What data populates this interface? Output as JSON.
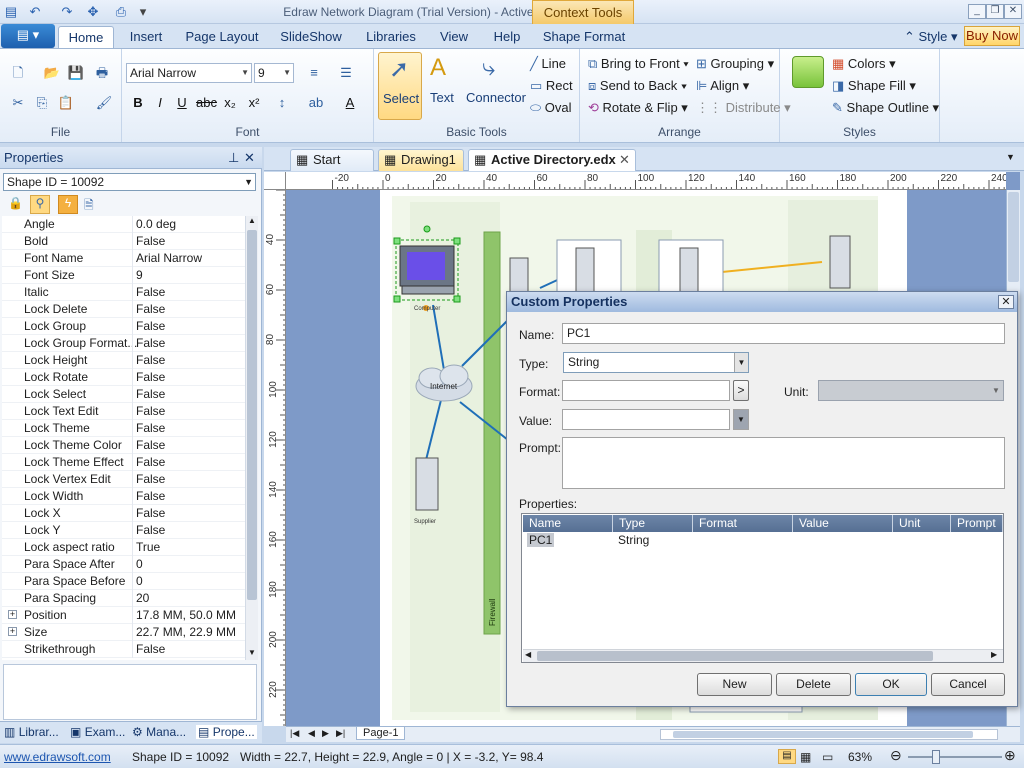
{
  "window": {
    "title": "Edraw Network Diagram (Trial Version) - Active Directory.edx",
    "context_tools": "Context Tools"
  },
  "ribbon": {
    "tabs": [
      "Home",
      "Insert",
      "Page Layout",
      "SlideShow",
      "Libraries",
      "View",
      "Help",
      "Shape Format"
    ],
    "active_tab": "Home",
    "style_label": "Style",
    "buy_now": "Buy Now",
    "font_name": "Arial Narrow",
    "font_size": "9",
    "basic_tools": {
      "select": "Select",
      "text": "Text",
      "connector": "Connector",
      "line": "Line",
      "rect": "Rect",
      "oval": "Oval"
    },
    "arrange": {
      "bring_to_front": "Bring to Front",
      "send_to_back": "Send to Back",
      "rotate_flip": "Rotate & Flip",
      "grouping": "Grouping",
      "align": "Align",
      "distribute": "Distribute"
    },
    "styles": {
      "colors": "Colors",
      "shape_fill": "Shape Fill",
      "shape_outline": "Shape Outline"
    },
    "groups": [
      "File",
      "Font",
      "Basic Tools",
      "Arrange",
      "Styles"
    ]
  },
  "properties_pane": {
    "title": "Properties",
    "shape_id": "Shape ID = 10092",
    "rows": [
      {
        "name": "Angle",
        "value": "0.0 deg"
      },
      {
        "name": "Bold",
        "value": "False"
      },
      {
        "name": "Font Name",
        "value": "Arial Narrow"
      },
      {
        "name": "Font Size",
        "value": "9"
      },
      {
        "name": "Italic",
        "value": "False"
      },
      {
        "name": "Lock Delete",
        "value": "False"
      },
      {
        "name": "Lock Group",
        "value": "False"
      },
      {
        "name": "Lock Group Format...",
        "value": "False"
      },
      {
        "name": "Lock Height",
        "value": "False"
      },
      {
        "name": "Lock Rotate",
        "value": "False"
      },
      {
        "name": "Lock Select",
        "value": "False"
      },
      {
        "name": "Lock Text Edit",
        "value": "False"
      },
      {
        "name": "Lock Theme",
        "value": "False"
      },
      {
        "name": "Lock Theme Color",
        "value": "False"
      },
      {
        "name": "Lock Theme Effect",
        "value": "False"
      },
      {
        "name": "Lock Vertex Edit",
        "value": "False"
      },
      {
        "name": "Lock Width",
        "value": "False"
      },
      {
        "name": "Lock X",
        "value": "False"
      },
      {
        "name": "Lock Y",
        "value": "False"
      },
      {
        "name": "Lock aspect ratio",
        "value": "True"
      },
      {
        "name": "Para Space After",
        "value": "0"
      },
      {
        "name": "Para Space Before",
        "value": "0"
      },
      {
        "name": "Para Spacing",
        "value": "20"
      },
      {
        "name": "Position",
        "value": "17.8 MM, 50.0 MM",
        "expandable": true
      },
      {
        "name": "Size",
        "value": "22.7 MM, 22.9 MM",
        "expandable": true
      },
      {
        "name": "Strikethrough",
        "value": "False"
      }
    ],
    "bottom_tabs": [
      "Librar...",
      "Exam...",
      "Mana...",
      "Prope..."
    ]
  },
  "documents": {
    "tabs": [
      "Start Page",
      "Drawing1",
      "Active Directory.edx"
    ],
    "active": "Active Directory.edx",
    "page_tab": "Page-1"
  },
  "ruler": {
    "h": [
      "-20",
      "0",
      "20",
      "40",
      "60",
      "80",
      "100",
      "120",
      "140",
      "160",
      "180",
      "200",
      "220",
      "240"
    ],
    "v": [
      "40",
      "60",
      "80",
      "100",
      "120",
      "140",
      "160",
      "180",
      "200",
      "220"
    ]
  },
  "diagram": {
    "labels": {
      "computer": "Computer",
      "internet": "Internet",
      "supplier": "Supplier",
      "firewall": "Firewall"
    }
  },
  "dialog": {
    "title": "Custom Properties",
    "name_label": "Name:",
    "name_value": "PC1",
    "type_label": "Type:",
    "type_value": "String",
    "format_label": "Format:",
    "format_button": ">",
    "unit_label": "Unit:",
    "value_label": "Value:",
    "prompt_label": "Prompt:",
    "properties_label": "Properties:",
    "columns": [
      "Name",
      "Type",
      "Format",
      "Value",
      "Unit",
      "Prompt"
    ],
    "rows": [
      {
        "name": "PC1",
        "type": "String"
      }
    ],
    "buttons": {
      "new": "New",
      "delete": "Delete",
      "ok": "OK",
      "cancel": "Cancel"
    }
  },
  "status": {
    "link": "www.edrawsoft.com",
    "shape_id": "Shape ID = 10092",
    "info": "Width = 22.7, Height = 22.9, Angle = 0 | X = -3.2, Y= 98.4",
    "zoom": "63%"
  },
  "colors": {
    "accent": "#2b5797",
    "selected_tool": "#ffd982",
    "context": "#f4c96a",
    "canvas_bg": "#7e9ac8",
    "firewall": "#8fc46a",
    "link": "#1f6fb8",
    "orange_link": "#f0b020"
  }
}
